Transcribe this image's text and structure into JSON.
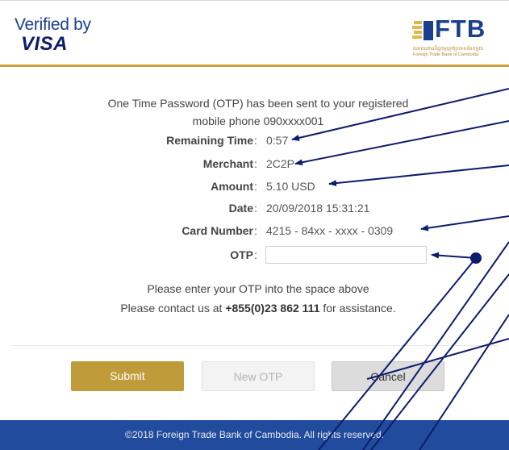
{
  "header": {
    "verified_by": "Verified by",
    "visa": "VISA",
    "bank_logo_text": "FTB",
    "bank_logo_khmer": "ធនាគារពាណិជ្ជកម្មក្រៅប្រទេសនៃកម្ពុជា",
    "bank_logo_english": "Foreign Trade Bank of Cambodia"
  },
  "intro": {
    "line1": "One Time Password (OTP) has been sent to your registered",
    "line2": "mobile phone 090xxxx001"
  },
  "fields": {
    "remaining_time": {
      "label": "Remaining Time",
      "value": "0:57"
    },
    "merchant": {
      "label": "Merchant",
      "value": "2C2P"
    },
    "amount": {
      "label": "Amount",
      "value": "5.10 USD"
    },
    "date": {
      "label": "Date",
      "value": "20/09/2018 15:31:21"
    },
    "card_number": {
      "label": "Card Number",
      "value": "4215 - 84xx - xxxx - 0309"
    },
    "otp": {
      "label": "OTP",
      "value": ""
    }
  },
  "instructions": {
    "line1": "Please enter your OTP into the space above",
    "line2_prefix": "Please contact us at ",
    "phone": "+855(0)23 862 111",
    "line2_suffix": " for assistance."
  },
  "buttons": {
    "submit": "Submit",
    "new_otp": "New OTP",
    "cancel": "Cancel"
  },
  "footer": {
    "copyright": "©2018 Foreign Trade Bank of Cambodia. All rights reserved."
  },
  "colors": {
    "gold": "#bf9b3a",
    "navy": "#214b9c",
    "annotation": "#0d1c6b"
  }
}
